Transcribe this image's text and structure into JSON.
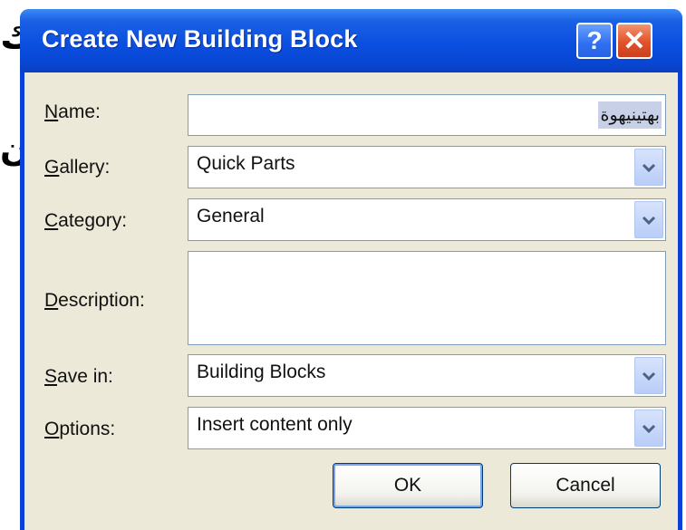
{
  "dialog": {
    "title": "Create New Building Block",
    "help_label": "?",
    "close_label": "✕"
  },
  "background": {
    "glyph_1": "ك",
    "glyph_2": "ن"
  },
  "fields": {
    "name": {
      "label_u": "N",
      "label_rest": "ame:",
      "value": "بهتينيهوة"
    },
    "gallery": {
      "label_u": "G",
      "label_rest": "allery:",
      "value": "Quick Parts"
    },
    "category": {
      "label_u": "C",
      "label_rest": "ategory:",
      "value": "General"
    },
    "description": {
      "label_u": "D",
      "label_rest": "escription:",
      "value": ""
    },
    "save_in": {
      "label_u": "S",
      "label_rest": "ave in:",
      "value": "Building Blocks"
    },
    "options": {
      "label_u": "O",
      "label_rest": "ptions:",
      "value": "Insert content only"
    }
  },
  "buttons": {
    "ok": "OK",
    "cancel": "Cancel"
  },
  "colors": {
    "title_bar": "#0b4fe0",
    "client_bg": "#ece9d8",
    "close_button": "#e2522a"
  },
  "icons": {
    "dropdown": "chevron-down-icon",
    "help": "help-icon",
    "close": "close-icon"
  }
}
